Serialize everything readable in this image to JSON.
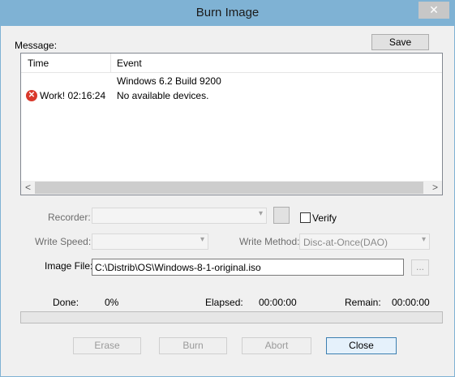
{
  "window": {
    "title": "Burn Image",
    "close_glyph": "✕"
  },
  "message": {
    "label": "Message:",
    "save_button": "Save",
    "columns": [
      "Time",
      "Event"
    ],
    "rows": [
      {
        "time": "",
        "event": "Windows 6.2 Build 9200",
        "icon": ""
      },
      {
        "time": "Work! 02:16:24",
        "event": "No available devices.",
        "icon": "error-icon"
      }
    ],
    "scroll_left": "<",
    "scroll_right": ">"
  },
  "recorder": {
    "label": "Recorder:",
    "value": "",
    "verify_label": "Verify",
    "verify_checked": false
  },
  "write_speed": {
    "label": "Write Speed:",
    "value": ""
  },
  "write_method": {
    "label": "Write Method:",
    "value": "Disc-at-Once(DAO)"
  },
  "image_file": {
    "label": "Image File:",
    "value": "C:\\Distrib\\OS\\Windows-8-1-original.iso",
    "browse_label": "..."
  },
  "status": {
    "done_label": "Done:",
    "done_value": "0%",
    "elapsed_label": "Elapsed:",
    "elapsed_value": "00:00:00",
    "remain_label": "Remain:",
    "remain_value": "00:00:00",
    "progress": 0
  },
  "buttons": {
    "erase": "Erase",
    "burn": "Burn",
    "abort": "Abort",
    "close": "Close"
  }
}
